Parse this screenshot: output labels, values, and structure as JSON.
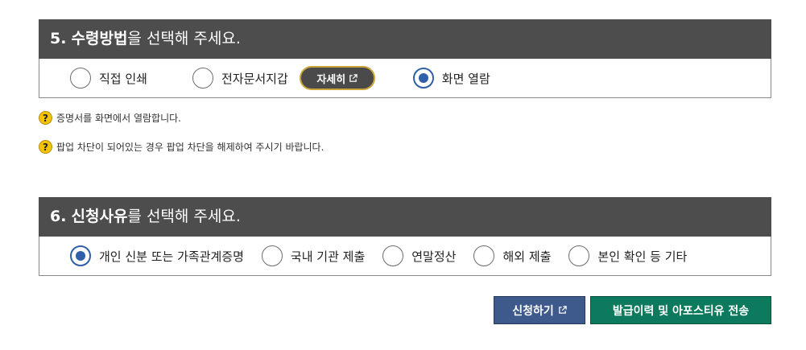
{
  "section5": {
    "number": "5.",
    "title_bold": "수령방법",
    "title_rest": "을 선택해 주세요.",
    "options": [
      {
        "label": "직접 인쇄",
        "checked": false
      },
      {
        "label": "전자문서지갑",
        "checked": false
      },
      {
        "label": "화면 열람",
        "checked": true
      }
    ],
    "detail_button": "자세히"
  },
  "notes": [
    {
      "icon": "?",
      "text": "증명서를 화면에서 열람합니다."
    },
    {
      "icon": "?",
      "text": "팝업 차단이 되어있는 경우 팝업 차단을 해제하여 주시기 바랍니다."
    }
  ],
  "section6": {
    "number": "6.",
    "title_bold": "신청사유",
    "title_rest": "를 선택해 주세요.",
    "options": [
      {
        "label": "개인 신분 또는 가족관계증명",
        "checked": true
      },
      {
        "label": "국내 기관 제출",
        "checked": false
      },
      {
        "label": "연말정산",
        "checked": false
      },
      {
        "label": "해외 제출",
        "checked": false
      },
      {
        "label": "본인 확인 등 기타",
        "checked": false
      }
    ]
  },
  "buttons": {
    "apply": "신청하기",
    "send": "발급이력 및 아포스티유 전송"
  },
  "colors": {
    "header_bg": "#4d4d4d",
    "radio_accent": "#2e5fa8",
    "apply_bg": "#3e5a8c",
    "send_bg": "#0d7a5e",
    "question_icon": "#f5c400"
  }
}
